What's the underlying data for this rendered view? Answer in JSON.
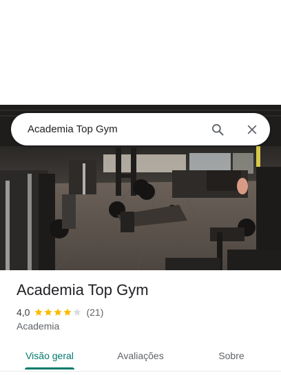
{
  "search": {
    "query": "Academia Top Gym",
    "search_icon": "search-icon",
    "close_icon": "close-icon"
  },
  "photo": {
    "subject": "gym-interior-photo"
  },
  "place": {
    "name": "Academia Top Gym",
    "rating": "4,0",
    "rating_value": 4.0,
    "rating_max": 5,
    "review_count": "(21)",
    "category": "Academia"
  },
  "tabs": [
    {
      "label": "Visão geral",
      "active": true
    },
    {
      "label": "Avaliações",
      "active": false
    },
    {
      "label": "Sobre",
      "active": false
    }
  ],
  "colors": {
    "accent": "#00796b",
    "star": "#fbbc04",
    "star_empty": "#dadce0"
  }
}
